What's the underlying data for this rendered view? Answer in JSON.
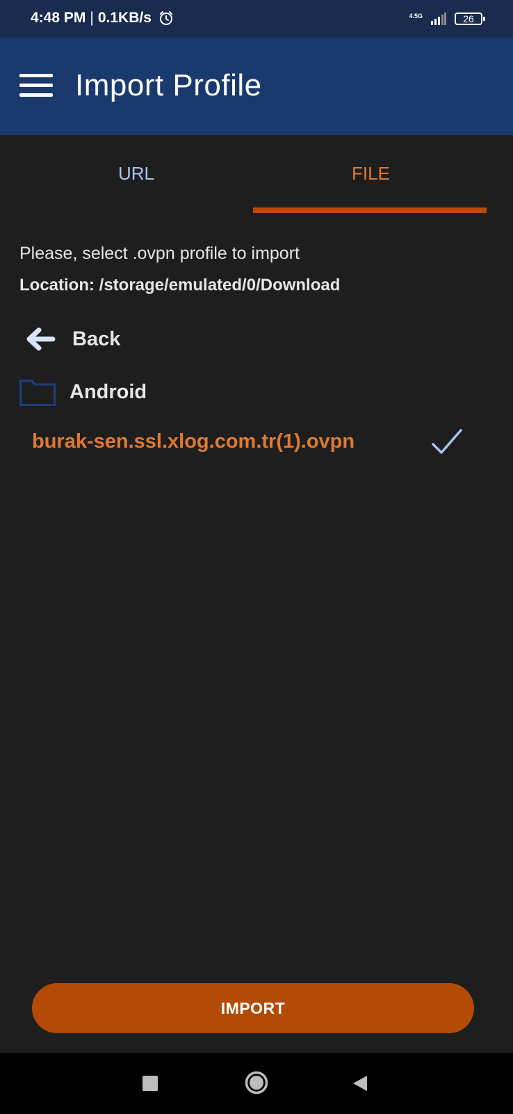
{
  "status_bar": {
    "time": "4:48 PM",
    "separator": "|",
    "speed": "0.1KB/s",
    "network_type": "4.5G",
    "battery_level": "26",
    "icons": [
      "alarm-icon",
      "signal-icon",
      "battery-icon"
    ]
  },
  "app_bar": {
    "title": "Import Profile",
    "menu_icon": "hamburger-menu-icon"
  },
  "tabs": [
    {
      "label": "URL",
      "selected": false
    },
    {
      "label": "FILE",
      "selected": true
    }
  ],
  "content": {
    "instructions": "Please, select .ovpn profile to import",
    "location": "Location: /storage/emulated/0/Download",
    "entries": [
      {
        "type": "back",
        "label": "Back",
        "icon": "back-arrow-icon"
      },
      {
        "type": "folder",
        "label": "Android",
        "icon": "folder-icon"
      },
      {
        "type": "file",
        "label": "burak-sen.ssl.xlog.com.tr(1).ovpn",
        "icon": "checkmark-icon",
        "selected": true
      }
    ]
  },
  "import_button": {
    "label": "IMPORT"
  },
  "colors": {
    "status_bar": "#1a2c4e",
    "app_bar": "#1a3a6e",
    "background": "#1e1e1e",
    "accent_orange": "#e07a30",
    "button_orange": "#b34a05",
    "tab_inactive": "#a8c4f0"
  }
}
